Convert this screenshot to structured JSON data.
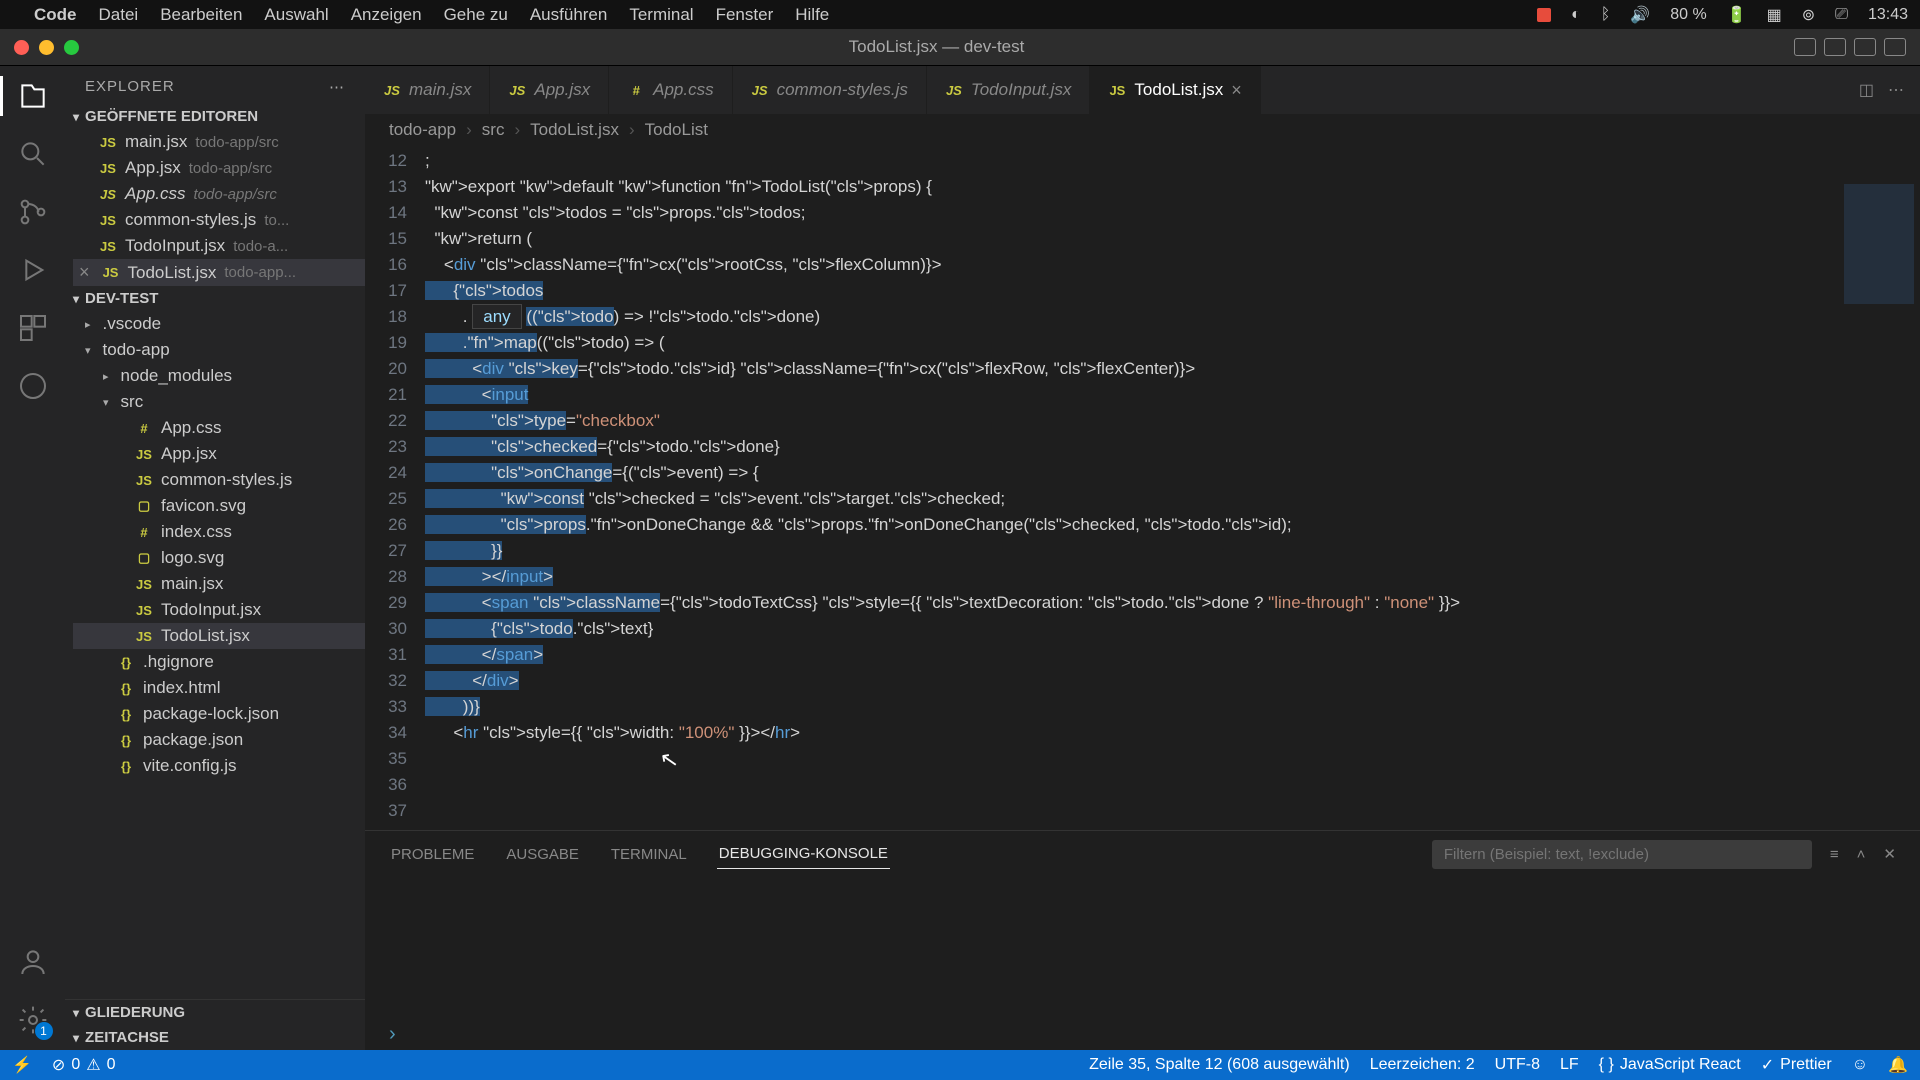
{
  "menubar": {
    "app": "Code",
    "items": [
      "Datei",
      "Bearbeiten",
      "Auswahl",
      "Anzeigen",
      "Gehe zu",
      "Ausführen",
      "Terminal",
      "Fenster",
      "Hilfe"
    ],
    "battery": "80 %",
    "time": "13:43"
  },
  "window": {
    "title": "TodoList.jsx — dev-test"
  },
  "explorer": {
    "title": "EXPLORER",
    "open_editors_label": "GEÖFFNETE EDITOREN",
    "project_label": "DEV-TEST",
    "outline_label": "GLIEDERUNG",
    "timeline_label": "ZEITACHSE",
    "open_editors": [
      {
        "name": "main.jsx",
        "hint": "todo-app/src"
      },
      {
        "name": "App.jsx",
        "hint": "todo-app/src"
      },
      {
        "name": "App.css",
        "hint": "todo-app/src",
        "italic": true
      },
      {
        "name": "common-styles.js",
        "hint": "to..."
      },
      {
        "name": "TodoInput.jsx",
        "hint": "todo-a..."
      },
      {
        "name": "TodoList.jsx",
        "hint": "todo-app...",
        "active": true,
        "close": true
      }
    ],
    "tree": {
      "vscode": ".vscode",
      "todo_app": "todo-app",
      "node_modules": "node_modules",
      "src": "src",
      "files": [
        "App.css",
        "App.jsx",
        "common-styles.js",
        "favicon.svg",
        "index.css",
        "logo.svg",
        "main.jsx",
        "TodoInput.jsx",
        "TodoList.jsx"
      ],
      "root_files": [
        ".hgignore",
        "index.html",
        "package-lock.json",
        "package.json",
        "vite.config.js"
      ]
    }
  },
  "tabs": [
    {
      "label": "main.jsx"
    },
    {
      "label": "App.jsx"
    },
    {
      "label": "App.css"
    },
    {
      "label": "common-styles.js"
    },
    {
      "label": "TodoInput.jsx"
    },
    {
      "label": "TodoList.jsx",
      "active": true
    }
  ],
  "breadcrumbs": [
    "todo-app",
    "src",
    "TodoList.jsx",
    "TodoList"
  ],
  "code": {
    "first_line": 12,
    "hint": "any",
    "lines": [
      ";",
      "",
      "export default function TodoList(props) {",
      "  const todos = props.todos;",
      "",
      "  return (",
      "    <div className={cx(rootCss, flexColumn)}>",
      "      {todos",
      "        .       ((todo) => !todo.done)",
      "        .map((todo) => (",
      "          <div key={todo.id} className={cx(flexRow, flexCenter)}>",
      "            <input",
      "              type=\"checkbox\"",
      "              checked={todo.done}",
      "              onChange={(event) => {",
      "                const checked = event.target.checked;",
      "                props.onDoneChange && props.onDoneChange(checked, todo.id);",
      "              }}",
      "            ></input>",
      "            <span className={todoTextCss} style={{ textDecoration: todo.done ? \"line-through\" : \"none\" }}>",
      "              {todo.text}",
      "            </span>",
      "          </div>",
      "        ))}",
      "",
      "      <hr style={{ width: \"100%\" }}></hr>"
    ]
  },
  "panel": {
    "tabs": [
      "PROBLEME",
      "AUSGABE",
      "TERMINAL",
      "DEBUGGING-KONSOLE"
    ],
    "active_tab": "DEBUGGING-KONSOLE",
    "filter_placeholder": "Filtern (Beispiel: text, !exclude)"
  },
  "status": {
    "errors": "0",
    "warnings": "0",
    "position": "Zeile 35, Spalte 12 (608 ausgewählt)",
    "indent": "Leerzeichen: 2",
    "encoding": "UTF-8",
    "eol": "LF",
    "lang": "JavaScript React",
    "prettier": "Prettier"
  },
  "activity_badge": "1"
}
